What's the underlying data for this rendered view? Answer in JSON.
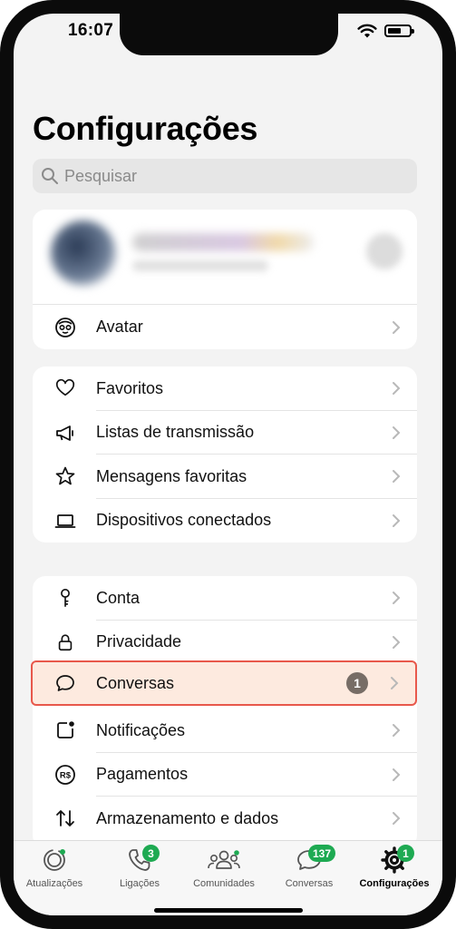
{
  "status_bar": {
    "time": "16:07",
    "battery_level": 0.7
  },
  "page": {
    "title": "Configurações"
  },
  "search": {
    "placeholder": "Pesquisar"
  },
  "profile": {
    "avatar_row": {
      "label": "Avatar",
      "icon": "avatar-face-icon"
    }
  },
  "section1": {
    "items": [
      {
        "label": "Favoritos",
        "icon": "heart-icon"
      },
      {
        "label": "Listas de transmissão",
        "icon": "megaphone-icon"
      },
      {
        "label": "Mensagens favoritas",
        "icon": "star-icon"
      },
      {
        "label": "Dispositivos conectados",
        "icon": "laptop-icon"
      }
    ]
  },
  "section2": {
    "items": [
      {
        "label": "Conta",
        "icon": "key-icon"
      },
      {
        "label": "Privacidade",
        "icon": "lock-icon"
      },
      {
        "label": "Conversas",
        "icon": "chat-bubble-icon",
        "badge": "1",
        "highlighted": true
      },
      {
        "label": "Notificações",
        "icon": "notification-icon"
      },
      {
        "label": "Pagamentos",
        "icon": "payment-rs-icon",
        "icon_text": "R$"
      },
      {
        "label": "Armazenamento e dados",
        "icon": "data-arrows-icon"
      }
    ]
  },
  "tabbar": {
    "tabs": [
      {
        "label": "Atualizações",
        "icon": "status-updates-icon"
      },
      {
        "label": "Ligações",
        "icon": "phone-icon",
        "badge": "3"
      },
      {
        "label": "Comunidades",
        "icon": "communities-icon"
      },
      {
        "label": "Conversas",
        "icon": "chats-icon",
        "badge": "137"
      },
      {
        "label": "Configurações",
        "icon": "settings-gear-icon",
        "badge": "1",
        "active": true
      }
    ]
  },
  "colors": {
    "accent": "#1eaa52",
    "highlight_border": "#e8584b",
    "highlight_fill": "#fdeadf",
    "badge_gray": "#776d66"
  }
}
